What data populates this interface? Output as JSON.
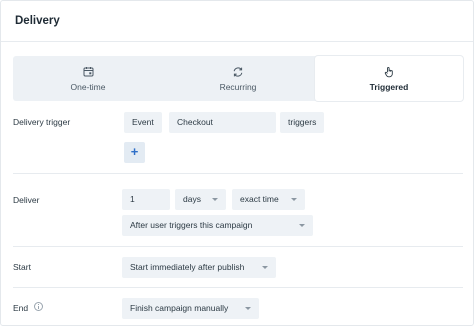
{
  "header": {
    "title": "Delivery"
  },
  "tabs": [
    {
      "label": "One-time",
      "icon": "calendar-icon"
    },
    {
      "label": "Recurring",
      "icon": "refresh-icon"
    },
    {
      "label": "Triggered",
      "icon": "hand-pointer-icon",
      "active": true
    }
  ],
  "delivery_trigger": {
    "label": "Delivery trigger",
    "event_chip": "Event",
    "event_value": "Checkout",
    "suffix": "triggers",
    "add_label": "+"
  },
  "deliver": {
    "label": "Deliver",
    "amount": "1",
    "unit": "days",
    "timing": "exact time",
    "when": "After user triggers this campaign"
  },
  "start": {
    "label": "Start",
    "value": "Start immediately after publish"
  },
  "end": {
    "label": "End",
    "value": "Finish campaign manually"
  }
}
